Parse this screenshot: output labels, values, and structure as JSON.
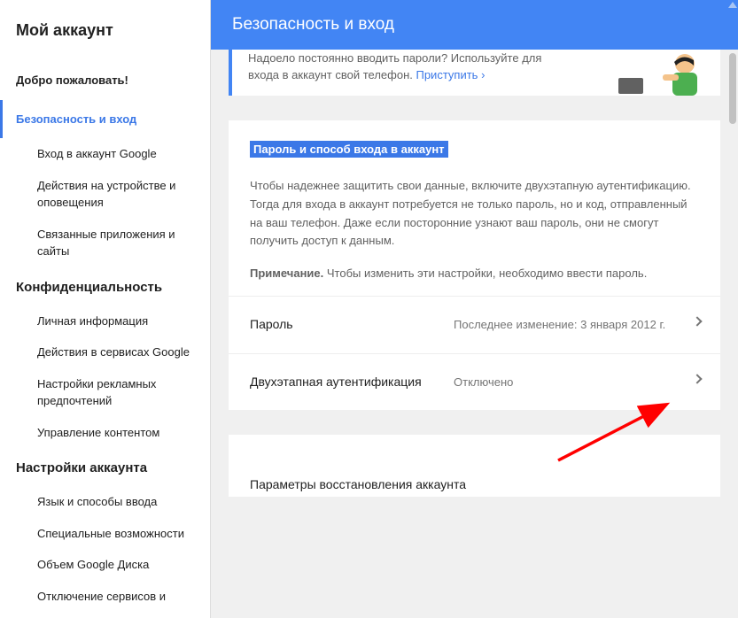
{
  "sidebar": {
    "title": "Мой аккаунт",
    "items": [
      {
        "label": "Добро пожаловать!",
        "type": "top"
      },
      {
        "label": "Безопасность и вход",
        "type": "top",
        "active": true
      },
      {
        "label": "Вход в аккаунт Google",
        "type": "sub"
      },
      {
        "label": "Действия на устройстве и оповещения",
        "type": "sub"
      },
      {
        "label": "Связанные приложения и сайты",
        "type": "sub"
      },
      {
        "label": "Конфиденциальность",
        "type": "section"
      },
      {
        "label": "Личная информация",
        "type": "sub"
      },
      {
        "label": "Действия в сервисах Google",
        "type": "sub"
      },
      {
        "label": "Настройки рекламных предпочтений",
        "type": "sub"
      },
      {
        "label": "Управление контентом",
        "type": "sub"
      },
      {
        "label": "Настройки аккаунта",
        "type": "section"
      },
      {
        "label": "Язык и способы ввода",
        "type": "sub"
      },
      {
        "label": "Специальные возможности",
        "type": "sub"
      },
      {
        "label": "Объем Google Диска",
        "type": "sub"
      },
      {
        "label": "Отключение сервисов и",
        "type": "sub"
      }
    ]
  },
  "header": {
    "title": "Безопасность и вход"
  },
  "promo": {
    "line1": "Надоело постоянно вводить пароли? Используйте для",
    "line2_prefix": "входа в аккаунт свой телефон. ",
    "link": "Приступить",
    "chevron": "›"
  },
  "card": {
    "subtitle": "Пароль и способ входа в аккаунт",
    "desc": "Чтобы надежнее защитить свои данные, включите двухэтапную аутентификацию. Тогда для входа в аккаунт потребуется не только пароль, но и код, отправленный на ваш телефон. Даже если посторонние узнают ваш пароль, они не смогут получить доступ к данным.",
    "note_bold": "Примечание.",
    "note_rest": " Чтобы изменить эти настройки, необходимо ввести пароль.",
    "rows": [
      {
        "label": "Пароль",
        "value": "Последнее изменение: 3 января 2012 г."
      },
      {
        "label": "Двухэтапная аутентификация",
        "value": "Отключено"
      }
    ]
  },
  "card2": {
    "title": "Параметры восстановления аккаунта"
  }
}
